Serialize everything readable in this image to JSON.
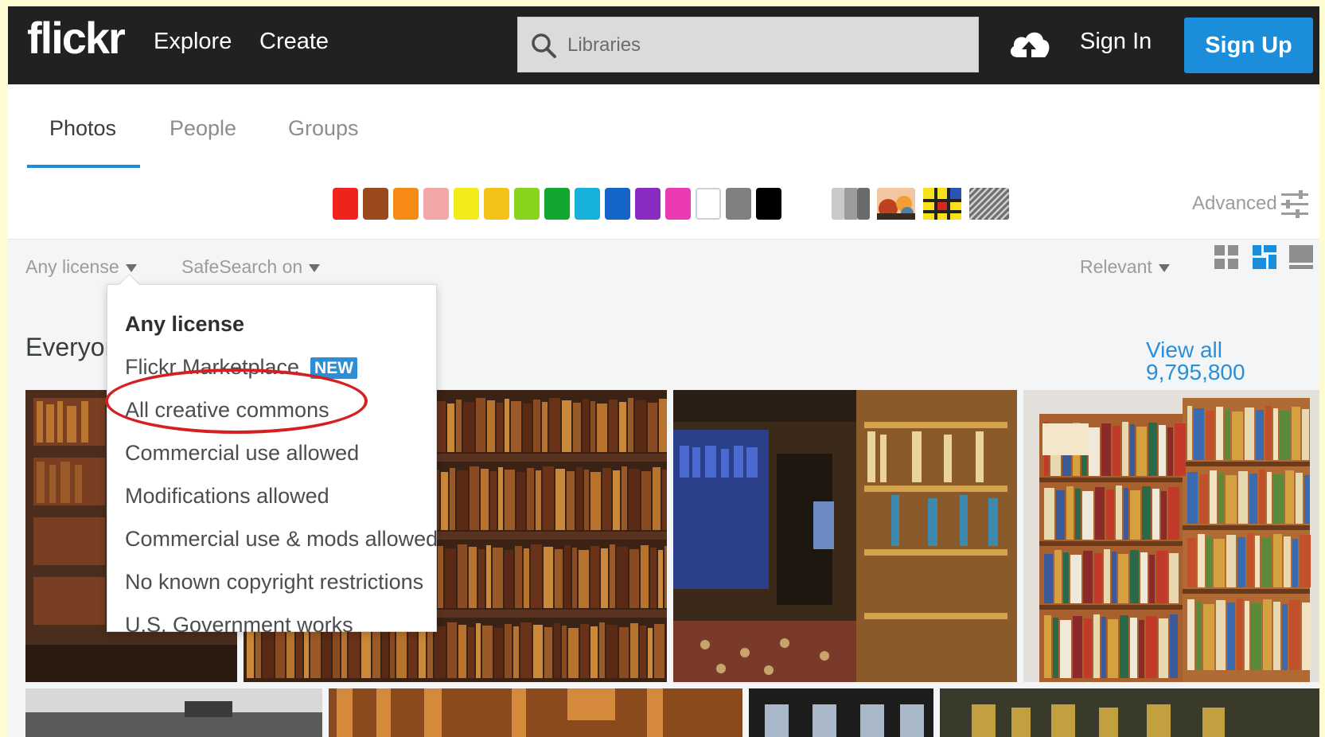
{
  "header": {
    "logo": "flickr",
    "nav": [
      "Explore",
      "Create"
    ],
    "search_placeholder": "Libraries",
    "upload_icon": "cloud-upload-icon",
    "sign_in": "Sign In",
    "sign_up": "Sign Up"
  },
  "tabs": [
    {
      "label": "Photos",
      "active": true
    },
    {
      "label": "People",
      "active": false
    },
    {
      "label": "Groups",
      "active": false
    }
  ],
  "color_filters": [
    "#f0221c",
    "#9a4a1c",
    "#f58a14",
    "#f3a7a9",
    "#f4ec1a",
    "#f5c21a",
    "#86d41c",
    "#13a62e",
    "#16b1d9",
    "#1565c8",
    "#8a2bc2",
    "#ec3ab3",
    "#ffffff",
    "#808080",
    "#000000"
  ],
  "style_filters": [
    "black-and-white",
    "shallow-depth-of-field",
    "minimalist",
    "patterns"
  ],
  "advanced": "Advanced",
  "filters": {
    "license": "Any license",
    "safesearch": "SafeSearch on",
    "sort": "Relevant"
  },
  "section": {
    "title": "Everyone",
    "view_all": "View all 9,795,800"
  },
  "license_menu": {
    "items": [
      "Any license",
      "Flickr Marketplace",
      "All creative commons",
      "Commercial use allowed",
      "Modifications allowed",
      "Commercial use & mods allowed",
      "No known copyright restrictions",
      "U.S. Government works"
    ],
    "new_badge": "NEW",
    "highlighted": "All creative commons",
    "highlight_color": "#d42020"
  },
  "accent_color": "#1c8ddb"
}
